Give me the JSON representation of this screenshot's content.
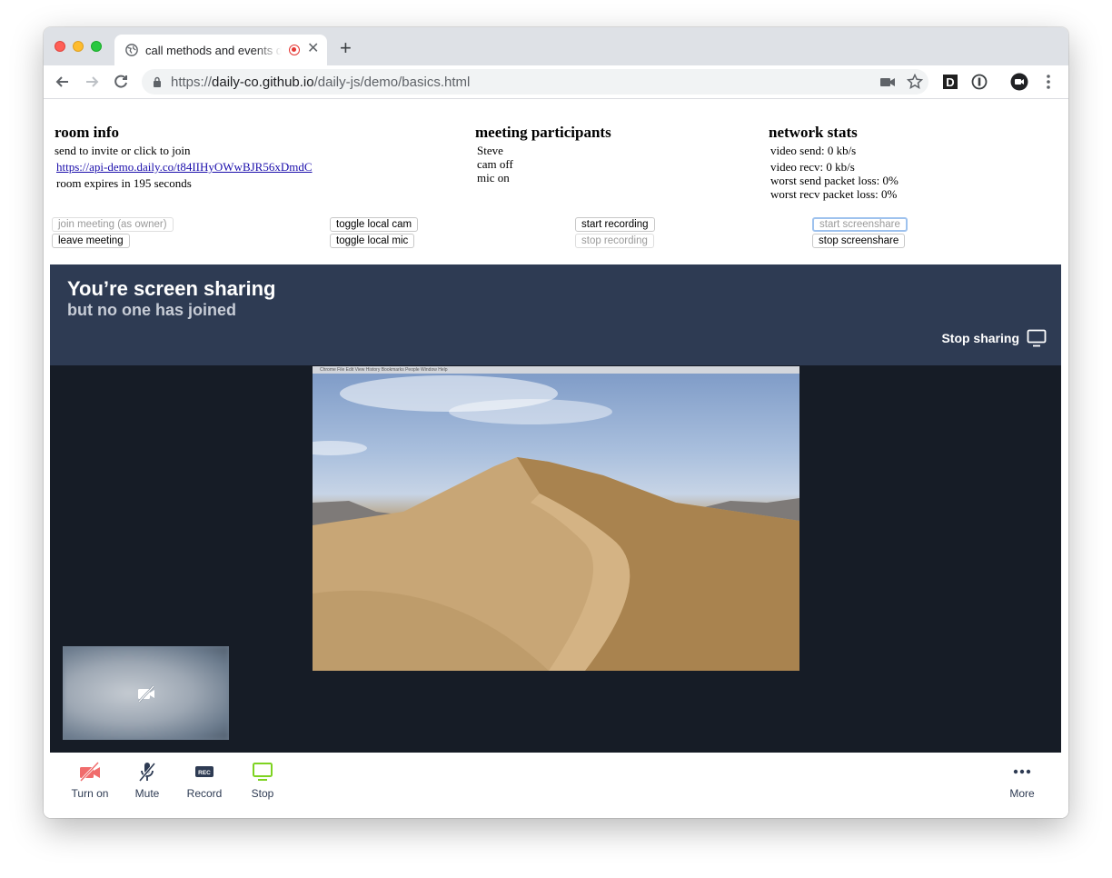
{
  "browser": {
    "tab_title": "call methods and events demo",
    "url_scheme": "https://",
    "url_host": "daily-co.github.io",
    "url_path": "/daily-js/demo/basics.html"
  },
  "room_info": {
    "heading": "room info",
    "invite_text": "send to invite or click to join",
    "room_url": "https://api-demo.daily.co/t84IIHyOWwBJR56xDmdC",
    "expires_text": "room expires in 195 seconds"
  },
  "participants": {
    "heading": "meeting participants",
    "name": "Steve",
    "cam": "cam off",
    "mic": "mic on"
  },
  "network": {
    "heading": "network stats",
    "video_send": "video send: 0 kb/s",
    "video_recv": "video recv: 0 kb/s",
    "send_loss": "worst send packet loss: 0%",
    "recv_loss": "worst recv packet loss: 0%"
  },
  "buttons": {
    "join": "join meeting (as owner)",
    "leave": "leave meeting",
    "toggle_cam": "toggle local cam",
    "toggle_mic": "toggle local mic",
    "start_recording": "start recording",
    "stop_recording": "stop recording",
    "start_screenshare": "start screenshare",
    "stop_screenshare": "stop screenshare"
  },
  "call": {
    "banner_title": "You’re screen sharing",
    "banner_subtitle": "but no one has joined",
    "stop_sharing": "Stop sharing",
    "shared_menubar": "Chrome   File   Edit   View   History   Bookmarks   People   Window   Help"
  },
  "tray": {
    "cam": "Turn on",
    "mic": "Mute",
    "record": "Record",
    "screen": "Stop",
    "more": "More",
    "rec_badge": "REC"
  },
  "colors": {
    "banner": "#2e3b53",
    "call_bg": "#161c26",
    "cam_off": "#f06c6c",
    "screen_active": "#7ed321"
  }
}
